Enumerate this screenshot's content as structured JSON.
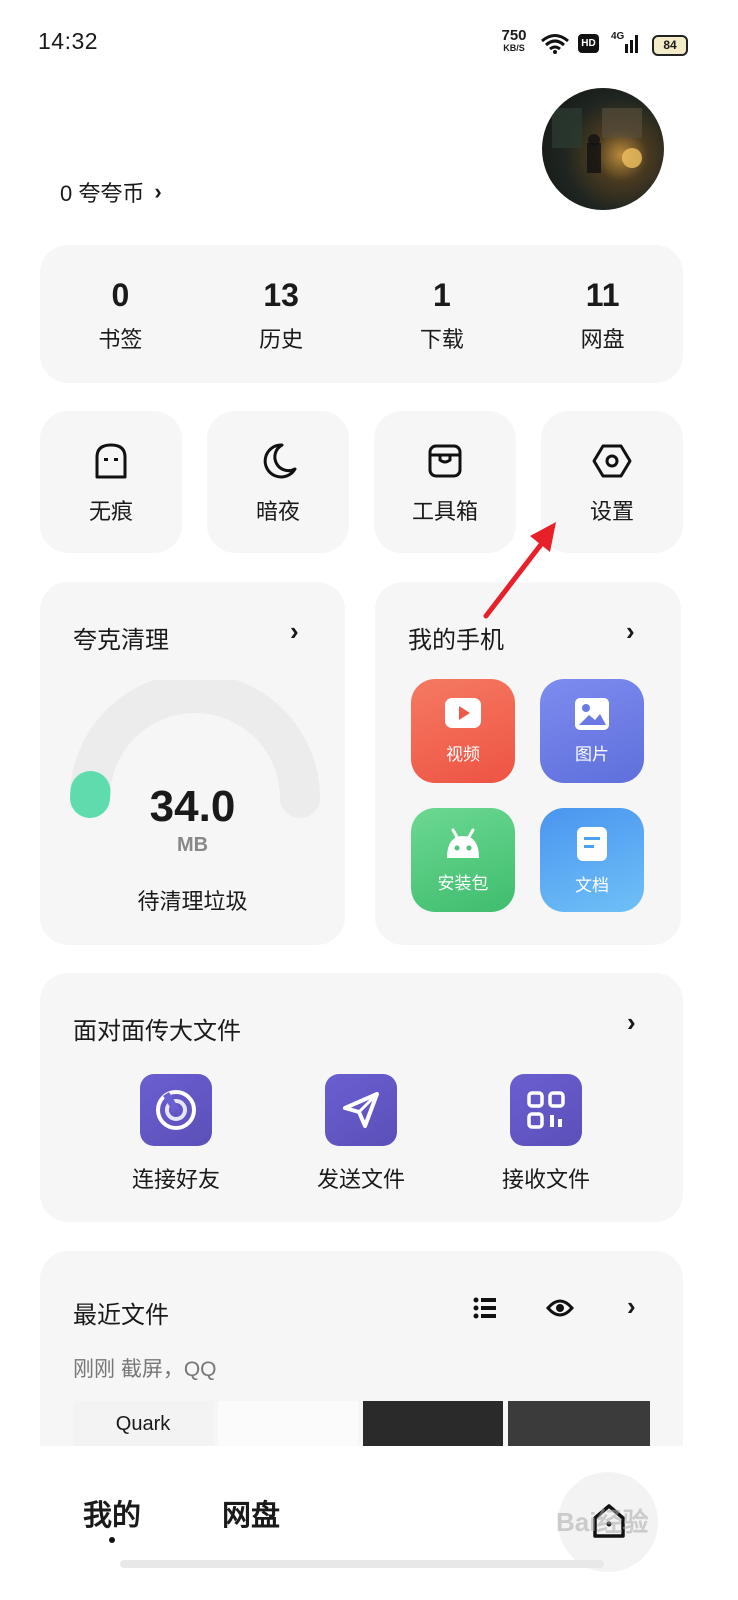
{
  "status_bar": {
    "time": "14:32",
    "net_speed_value": "750",
    "net_speed_unit": "KB/S",
    "hd_label": "HD",
    "network_label": "4G",
    "battery": "84"
  },
  "header": {
    "coins": "0 夸夸币",
    "chevron": "›"
  },
  "stats": [
    {
      "value": "0",
      "label": "书签"
    },
    {
      "value": "13",
      "label": "历史"
    },
    {
      "value": "1",
      "label": "下载"
    },
    {
      "value": "11",
      "label": "网盘"
    }
  ],
  "quick_tiles": [
    {
      "label": "无痕",
      "icon": "incognito-icon"
    },
    {
      "label": "暗夜",
      "icon": "moon-icon"
    },
    {
      "label": "工具箱",
      "icon": "toolbox-icon"
    },
    {
      "label": "设置",
      "icon": "hexagon-settings-icon"
    }
  ],
  "clean": {
    "title": "夸克清理",
    "chevron": "›",
    "value": "34.0",
    "unit": "MB",
    "subtitle": "待清理垃圾",
    "gauge_fraction": 0.03
  },
  "phone": {
    "title": "我的手机",
    "chevron": "›",
    "apps": [
      {
        "label": "视频",
        "icon": "video-icon",
        "color": "#f0624d"
      },
      {
        "label": "图片",
        "icon": "image-icon",
        "color": "#6f7fe6"
      },
      {
        "label": "安装包",
        "icon": "android-icon",
        "color": "#4fc77d"
      },
      {
        "label": "文档",
        "icon": "document-icon",
        "color": "#4aa3f2"
      }
    ]
  },
  "transfer": {
    "title": "面对面传大文件",
    "chevron": "›",
    "actions": [
      {
        "label": "连接好友",
        "icon": "radar-icon"
      },
      {
        "label": "发送文件",
        "icon": "send-icon"
      },
      {
        "label": "接收文件",
        "icon": "qr-icon"
      }
    ]
  },
  "recent": {
    "title": "最近文件",
    "meta": "刚刚  截屏，QQ",
    "chevron": "›",
    "thumb_brand": "Quark"
  },
  "bottom_nav": {
    "tab_mine": "我的",
    "tab_cloud": "网盘"
  },
  "watermark": "Bai经验",
  "colors": {
    "card_bg": "#f6f6f6",
    "accent_purple": "#5b4fb8",
    "gauge_green": "#5fdcae",
    "arrow_red": "#e8202a"
  }
}
